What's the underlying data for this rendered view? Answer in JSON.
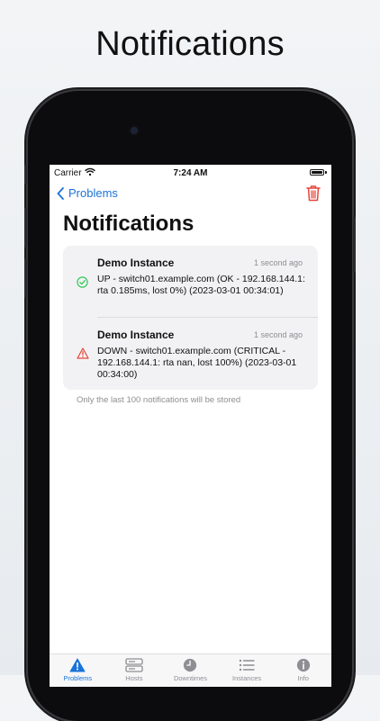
{
  "promo": {
    "title": "Notifications"
  },
  "status_bar": {
    "carrier": "Carrier",
    "time": "7:24 AM"
  },
  "nav": {
    "back_label": "Problems"
  },
  "page": {
    "title": "Notifications"
  },
  "notifications": [
    {
      "instance": "Demo Instance",
      "time": "1 second ago",
      "state": "ok",
      "message": "UP - switch01.example.com (OK - 192.168.144.1: rta 0.185ms, lost 0%) (2023-03-01 00:34:01)"
    },
    {
      "instance": "Demo Instance",
      "time": "1 second ago",
      "state": "critical",
      "message": "DOWN - switch01.example.com (CRITICAL - 192.168.144.1: rta nan, lost 100%) (2023-03-01 00:34:00)"
    }
  ],
  "footer_note": "Only the last 100 notifications will be stored",
  "tabs": [
    {
      "label": "Problems",
      "icon": "warning-icon",
      "active": true
    },
    {
      "label": "Hosts",
      "icon": "server-icon",
      "active": false
    },
    {
      "label": "Downtimes",
      "icon": "clock-icon",
      "active": false
    },
    {
      "label": "Instances",
      "icon": "list-icon",
      "active": false
    },
    {
      "label": "Info",
      "icon": "info-icon",
      "active": false
    }
  ],
  "colors": {
    "accent": "#1a73d9",
    "ok": "#34c759",
    "critical": "#e5453a",
    "muted": "#8e8e93"
  }
}
